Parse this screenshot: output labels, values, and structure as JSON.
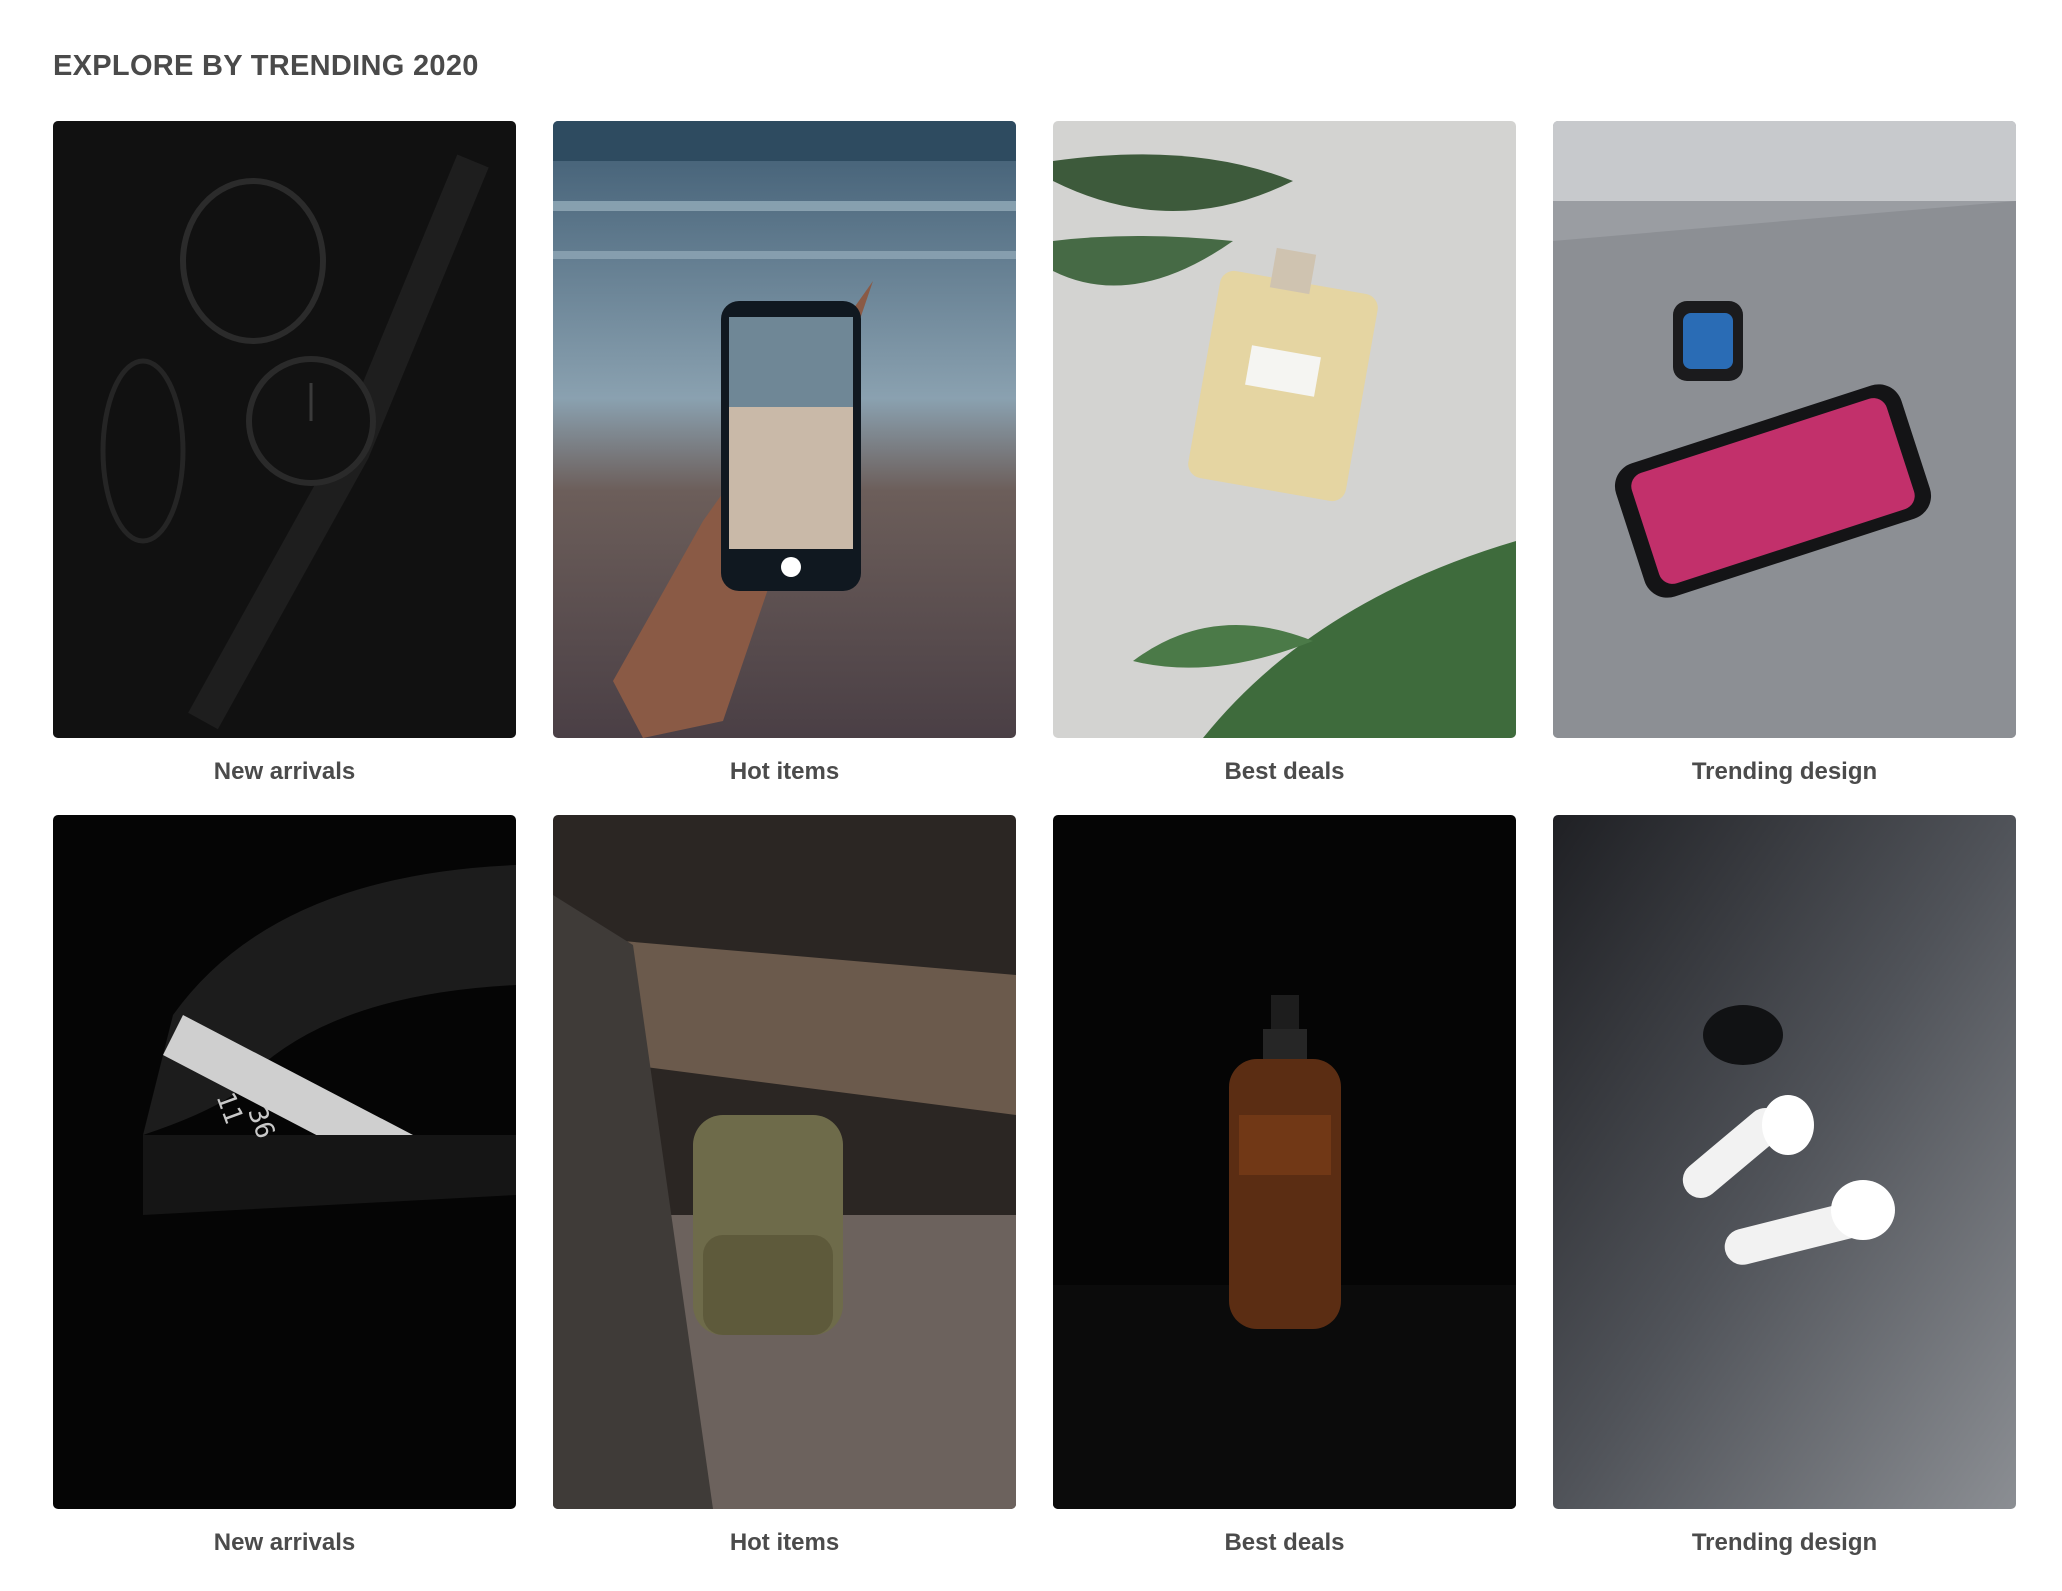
{
  "section": {
    "title": "EXPLORE BY TRENDING 2020"
  },
  "cards": [
    {
      "label": "New arrivals",
      "image": "black-wristwatch-and-sunglasses-photo"
    },
    {
      "label": "Hot items",
      "image": "hand-holding-smartphone-in-corridor-photo"
    },
    {
      "label": "Best deals",
      "image": "perfume-bottle-with-leaves-photo"
    },
    {
      "label": "Trending design",
      "image": "smartwatch-and-smartphone-on-wood-photo"
    },
    {
      "label": "New arrivals",
      "image": "fitness-tracker-band-photo"
    },
    {
      "label": "Hot items",
      "image": "backpack-under-log-photo"
    },
    {
      "label": "Best deals",
      "image": "amber-serum-bottle-photo"
    },
    {
      "label": "Trending design",
      "image": "wireless-earbuds-on-laptop-photo"
    }
  ]
}
